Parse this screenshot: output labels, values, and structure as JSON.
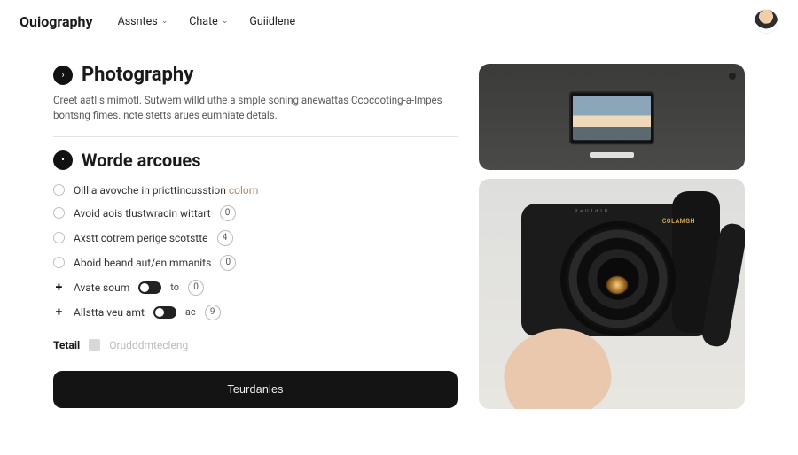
{
  "header": {
    "logo": "Quiography",
    "nav": [
      {
        "label": "Assntes",
        "has_chevron": true
      },
      {
        "label": "Chate",
        "has_chevron": true
      },
      {
        "label": "Guiidlene",
        "has_chevron": false
      }
    ]
  },
  "main": {
    "title_icon": "›",
    "title": "Photography",
    "description": "Creet aatlls mimotl. Sutwern willd uthe a smple soning anewattas Ccocooting-a-lmpes bontsng fimes. ncte stetts arues eumhiate detals.",
    "subsection_icon": "•",
    "subsection_title": "Worde arcoues",
    "options": [
      {
        "type": "radio",
        "label_pre": "Oillia avovche in pricttincusstion",
        "label_accent": "colorn",
        "suffix": null
      },
      {
        "type": "radio",
        "label": "Avoid aois tlustwracin wittart",
        "suffix": "0"
      },
      {
        "type": "radio",
        "label": "Axstt cotrem perige scotstte",
        "suffix": "4"
      },
      {
        "type": "radio",
        "label": "Aboid beand aut/en mmanits",
        "suffix": "0"
      },
      {
        "type": "plus",
        "label": "Avate soum",
        "toggle": true,
        "toggle_label": "to",
        "suffix": "0"
      },
      {
        "type": "plus",
        "label": "Allstta veu amt",
        "toggle": true,
        "toggle_label": "ac",
        "suffix": "9"
      }
    ],
    "tetail_label": "Tetail",
    "tetail_placeholder": "Orudddmtecleng",
    "cta": "Teurdanles"
  },
  "images": {
    "card1_alt": "monitor-on-shelf",
    "card2_brand": "COLAMGH",
    "card2_scale": "R e U  I d  I D"
  }
}
